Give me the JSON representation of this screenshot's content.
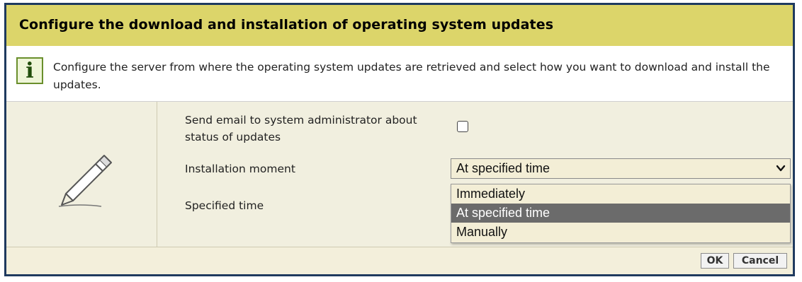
{
  "dialog": {
    "title": "Configure the download and installation of operating system updates",
    "info_icon": "info-icon",
    "info_text": "Configure the server from where the operating system updates are retrieved and select how you want to download and install the updates."
  },
  "form": {
    "edit_icon": "pencil-icon",
    "email_label": "Send email to system administrator about status of updates",
    "email_checked": false,
    "installation_label": "Installation moment",
    "installation_value": "At specified time",
    "installation_options": [
      "Immediately",
      "At specified time",
      "Manually"
    ],
    "specified_time_label": "Specified time"
  },
  "footer": {
    "ok_label": "OK",
    "cancel_label": "Cancel"
  },
  "colors": {
    "title_bar": "#dcd56a",
    "body_bg": "#f1efdf",
    "selected_option": "#6b6b6b",
    "border": "#1f3a5f"
  }
}
